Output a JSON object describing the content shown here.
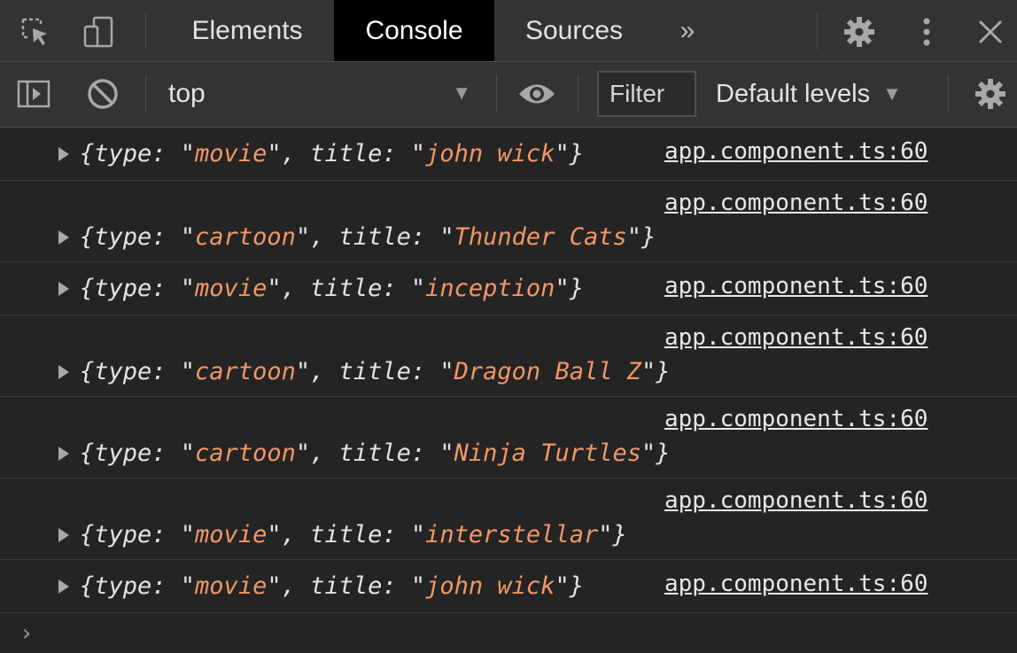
{
  "tabs": [
    {
      "label": "Elements"
    },
    {
      "label": "Console"
    },
    {
      "label": "Sources"
    }
  ],
  "more_tabs_glyph": "»",
  "toolbar": {
    "context": "top",
    "filter_label": "Filter",
    "levels_label": "Default levels"
  },
  "icons": {
    "inspect": "inspect-element-icon",
    "device": "device-toolbar-icon",
    "settings": "gear-icon",
    "menu": "vertical-dots-icon",
    "close": "close-icon",
    "sidebar": "show-sidebar-icon",
    "clear": "clear-console-icon",
    "live_expression": "eye-icon",
    "console_settings": "gear-icon"
  },
  "colors": {
    "string": "#f29766",
    "active_tab_bg": "#000000",
    "panel_bg": "#242424",
    "toolbar_bg": "#333333"
  },
  "messages": [
    {
      "type": "movie",
      "title": "john wick",
      "source": "app.component.ts:60",
      "layout": "single"
    },
    {
      "type": "cartoon",
      "title": "Thunder Cats",
      "source": "app.component.ts:60",
      "layout": "double"
    },
    {
      "type": "movie",
      "title": "inception",
      "source": "app.component.ts:60",
      "layout": "single"
    },
    {
      "type": "cartoon",
      "title": "Dragon Ball Z",
      "source": "app.component.ts:60",
      "layout": "double"
    },
    {
      "type": "cartoon",
      "title": "Ninja Turtles",
      "source": "app.component.ts:60",
      "layout": "double"
    },
    {
      "type": "movie",
      "title": "interstellar",
      "source": "app.component.ts:60",
      "layout": "double"
    },
    {
      "type": "movie",
      "title": "john wick",
      "source": "app.component.ts:60",
      "layout": "single"
    }
  ],
  "prompt_glyph": "›"
}
